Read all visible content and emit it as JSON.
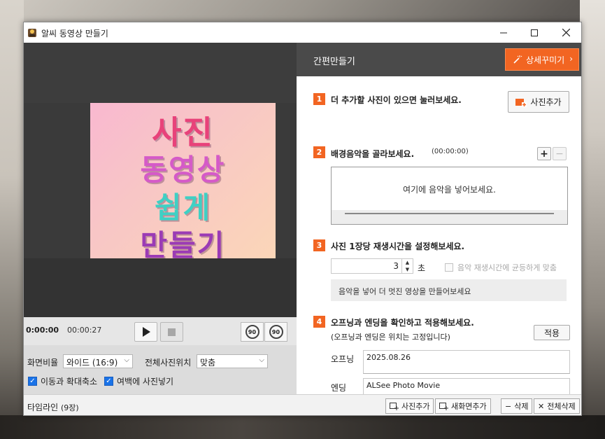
{
  "window": {
    "title": "알씨 동영상 만들기"
  },
  "preview": {
    "photo_lines": [
      "사진",
      "동영상",
      "쉽게",
      "만들기"
    ],
    "colors": {
      "line1": "#e8427a",
      "line2": "#d55ac8",
      "line3": "#3fd0c4",
      "line4": "#9b3bb5"
    }
  },
  "playbar": {
    "current_time": "0:00:00",
    "total_time": "00:00:27",
    "rotate_left_label": "90",
    "rotate_right_label": "90"
  },
  "options": {
    "aspect_label": "화면비율",
    "aspect_value": "와이드 (16:9)",
    "position_label": "전체사진위치",
    "position_value": "맞춤",
    "check_move_zoom": "이동과 확대축소",
    "check_fill_margin": "여백에 사진넣기"
  },
  "right": {
    "header_title": "간편만들기",
    "detail_button": "상세꾸미기",
    "steps": [
      {
        "num": "1",
        "title": "더 추가할 사진이 있으면 눌러보세요.",
        "button": "사진추가"
      },
      {
        "num": "2",
        "title": "배경음악을 골라보세요.",
        "duration": "(00:00:00)",
        "placeholder": "여기에 음악을 넣어보세요."
      },
      {
        "num": "3",
        "title": "사진 1장당 재생시간을 설정해보세요.",
        "seconds": "3",
        "unit": "초",
        "sync_label": "음악 재생시간에 균등하게 맞춤",
        "info": "음악을 넣어 더 멋진 영상을 만들어보세요"
      },
      {
        "num": "4",
        "title": "오프닝과 엔딩을 확인하고 적용해보세요.",
        "subtitle": "(오프닝과 엔딩은 위치는 고정입니다)",
        "apply_button": "적용",
        "opening_label": "오프닝",
        "opening_value": "2025.08.26",
        "ending_label": "엔딩",
        "ending_value": "ALSee Photo Movie"
      }
    ]
  },
  "footer": {
    "timeline_label": "타임라인",
    "timeline_count": "(9장)",
    "add_photo": "사진추가",
    "new_screen": "새화면추가",
    "delete": "삭제",
    "delete_all": "전체삭제"
  },
  "accent_color": "#f26522"
}
